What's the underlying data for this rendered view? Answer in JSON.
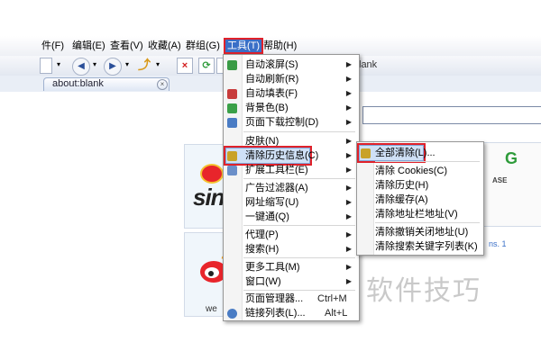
{
  "menubar": {
    "items": [
      "件(F)",
      "编辑(E)",
      "查看(V)",
      "收藏(A)",
      "群组(G)",
      "工具(T)",
      "帮助(H)"
    ],
    "active_index": 5
  },
  "toolbar": {
    "address_fragment": "lank"
  },
  "tab": {
    "label": "about:blank"
  },
  "tools_menu": {
    "items": [
      {
        "label": "自动滚屏(S)"
      },
      {
        "label": "自动刷新(R)"
      },
      {
        "label": "自动填表(F)"
      },
      {
        "label": "背景色(B)"
      },
      {
        "label": "页面下载控制(D)"
      },
      {
        "label": "皮肤(N)"
      },
      {
        "label": "清除历史信息(C)"
      },
      {
        "label": "扩展工具栏(E)"
      },
      {
        "label": "广告过滤器(A)"
      },
      {
        "label": "网址缩写(U)"
      },
      {
        "label": "一键通(Q)"
      },
      {
        "label": "代理(P)"
      },
      {
        "label": "搜索(H)"
      },
      {
        "label": "更多工具(M)"
      },
      {
        "label": "窗口(W)"
      },
      {
        "label": "页面管理器...",
        "shortcut": "Ctrl+M"
      },
      {
        "label": "链接列表(L)...",
        "shortcut": "Alt+L"
      }
    ]
  },
  "clear_history_menu": {
    "items": [
      {
        "label": "全部清除(L)..."
      },
      {
        "label": "清除 Cookies(C)"
      },
      {
        "label": "清除历史(H)"
      },
      {
        "label": "清除缓存(A)"
      },
      {
        "label": "清除地址栏地址(V)"
      },
      {
        "label": "清除撤销关闭地址(U)"
      },
      {
        "label": "清除搜索关键字列表(K)"
      }
    ]
  },
  "page": {
    "sina_text": "sin",
    "weibo_text": "we",
    "right_g": "G",
    "right_ase": "ASE",
    "right_ns": "ns. 1"
  },
  "watermark": "软件技巧",
  "colors": {
    "highlight_border": "#e0212a",
    "menu_selection": "#cfe0f6",
    "active_menu": "#3a6fc7"
  }
}
